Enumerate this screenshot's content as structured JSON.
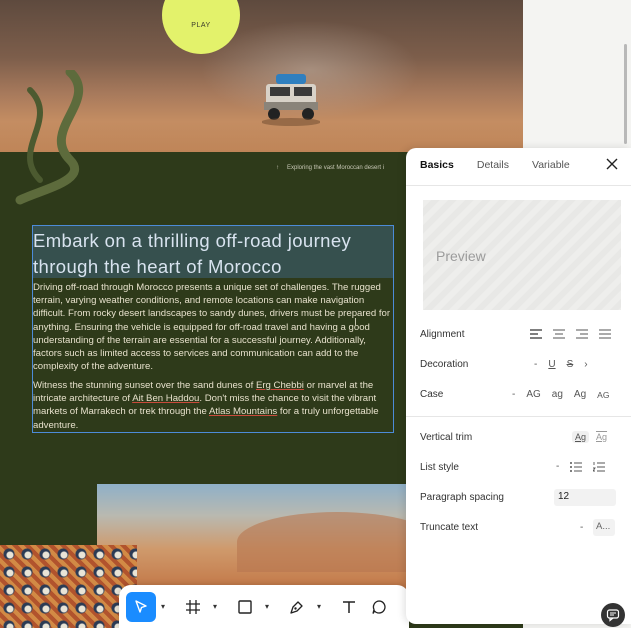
{
  "canvas": {
    "play_label": "PLAY",
    "caption_arrow": "↑",
    "caption_text": "Exploring the vast Moroccan desert i",
    "heading": "Embark on a thrilling off-road journey through the heart of Morocco",
    "para1": "Driving off-road through Morocco presents a unique set of challenges. The rugged terrain, varying weather conditions, and remote locations can make navigation difficult. From rocky desert landscapes to sandy dunes, drivers must be prepared for anything. Ensuring the vehicle is equipped for off-road travel and having a good understanding of the terrain are essential for a successful journey. Additionally, factors such as limited access to services and communication can add to the complexity of the adventure.",
    "para2_a": "Witness the stunning sunset over the sand dunes of ",
    "para2_link1": "Erg Chebbi",
    "para2_b": " or marvel at the intricate architecture of ",
    "para2_link2": "Ait Ben Haddou",
    "para2_c": ". Don't miss the chance to visit the vibrant markets of Marrakech or trek through the ",
    "para2_link3": "Atlas Mountains",
    "para2_d": " for a truly unforgettable adventure."
  },
  "toolbar": {
    "tools": [
      {
        "name": "move-tool",
        "icon": "pointer-icon",
        "active": true
      },
      {
        "name": "frame-tool",
        "icon": "frame-icon"
      },
      {
        "name": "shape-tool",
        "icon": "rectangle-icon"
      },
      {
        "name": "pen-tool",
        "icon": "pen-icon"
      },
      {
        "name": "text-tool",
        "icon": "text-icon"
      },
      {
        "name": "comment-tool",
        "icon": "comment-icon"
      }
    ],
    "accent": "#1a8cff"
  },
  "panel": {
    "tabs": [
      "Basics",
      "Details",
      "Variable"
    ],
    "active_tab": "Basics",
    "preview_label": "Preview",
    "alignment_label": "Alignment",
    "decoration_label": "Decoration",
    "decoration_options": [
      "-",
      "U",
      "S",
      "›"
    ],
    "case_label": "Case",
    "case_options": [
      "-",
      "AG",
      "ag",
      "Ag",
      "AG"
    ],
    "vertical_trim_label": "Vertical trim",
    "vertical_trim_options": [
      "Ag",
      "Ag"
    ],
    "list_style_label": "List style",
    "list_style_options": [
      "-"
    ],
    "paragraph_spacing_label": "Paragraph spacing",
    "paragraph_spacing_value": "12",
    "truncate_label": "Truncate text",
    "truncate_options": [
      "-"
    ],
    "truncate_value": "A..."
  }
}
